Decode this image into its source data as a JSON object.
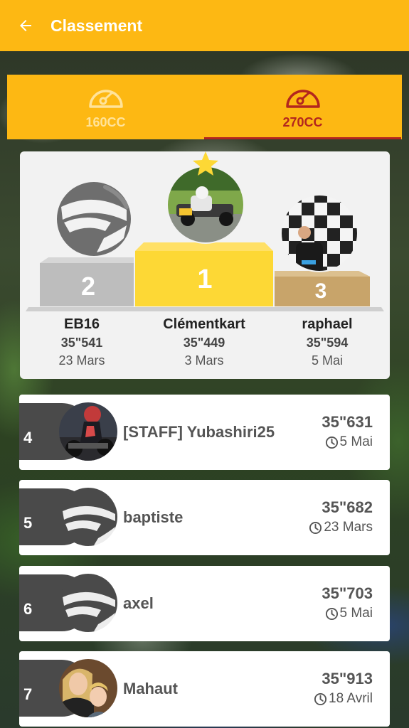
{
  "appbar": {
    "title": "Classement"
  },
  "tabs": [
    {
      "label": "160CC",
      "active": false
    },
    {
      "label": "270CC",
      "active": true
    }
  ],
  "podium": {
    "second": {
      "rank": "2",
      "name": "EB16",
      "time": "35\"541",
      "date": "23 Mars"
    },
    "first": {
      "rank": "1",
      "name": "Clémentkart",
      "time": "35\"449",
      "date": "3 Mars"
    },
    "third": {
      "rank": "3",
      "name": "raphael",
      "time": "35\"594",
      "date": "5 Mai"
    }
  },
  "leaderboard": [
    {
      "rank": "4",
      "name": "[STAFF] Yubashiri25",
      "time": "35\"631",
      "date": "5 Mai"
    },
    {
      "rank": "5",
      "name": "baptiste",
      "time": "35\"682",
      "date": "23 Mars"
    },
    {
      "rank": "6",
      "name": "axel",
      "time": "35\"703",
      "date": "5 Mai"
    },
    {
      "rank": "7",
      "name": "Mahaut",
      "time": "35\"913",
      "date": "18 Avril"
    }
  ],
  "colors": {
    "appbar": "#FDB813",
    "active_tab": "#B3261E",
    "gold": "#FDD835",
    "silver": "#BDBDBD",
    "bronze": "#C8A46A",
    "rank_tab": "#4A4A4A"
  }
}
